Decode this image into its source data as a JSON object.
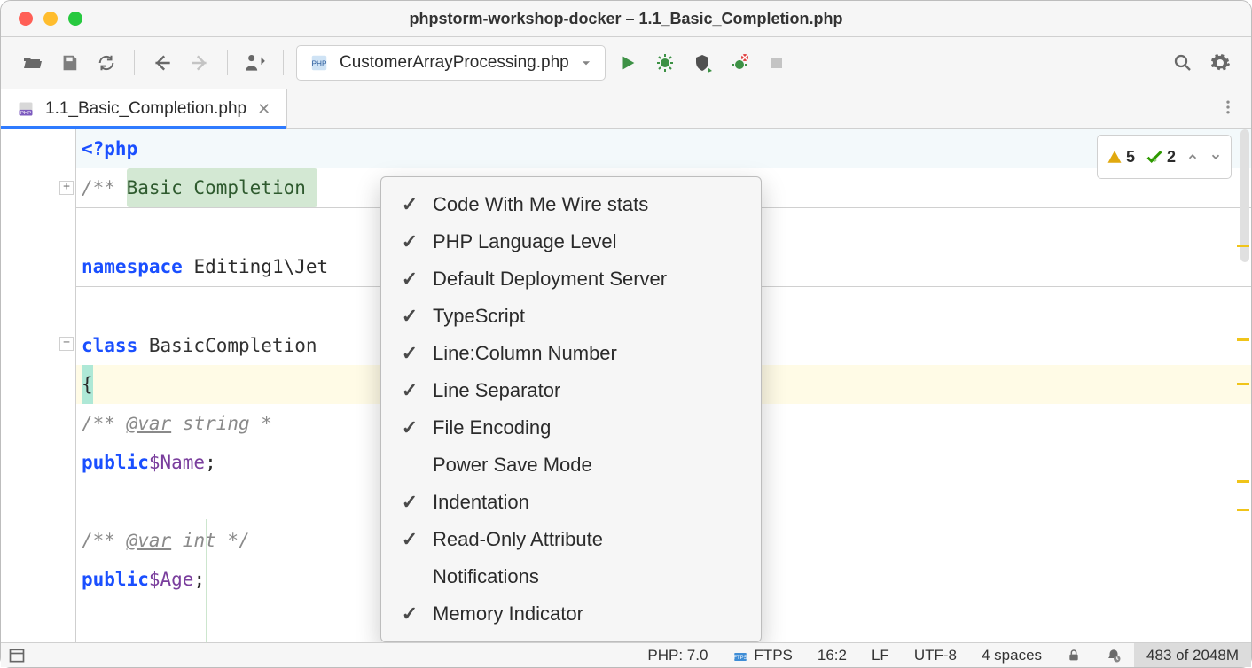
{
  "window": {
    "title": "phpstorm-workshop-docker – 1.1_Basic_Completion.php"
  },
  "runConfig": {
    "label": "CustomerArrayProcessing.php"
  },
  "tab": {
    "label": "1.1_Basic_Completion.php"
  },
  "inspections": {
    "warnings": "5",
    "oks": "2"
  },
  "code": {
    "l1": "<?php",
    "doc_lead": "/** ",
    "doc_title": "Basic Completion ",
    "namespace_kw": "namespace ",
    "namespace_val": "Editing1\\Jet",
    "class_kw": "class ",
    "class_name": "BasicCompletion",
    "brace_open": "{",
    "doc_var1_a": "/** ",
    "doc_var1_tag": "@var",
    "doc_var1_b": " string *",
    "public_kw": "public",
    "name_var": "$Name",
    "semi": ";",
    "doc_var2_a": "/** ",
    "doc_var2_tag": "@var",
    "doc_var2_b": " int */",
    "age_var": "$Age"
  },
  "menu": {
    "items": [
      {
        "label": "Code With Me Wire stats",
        "checked": true
      },
      {
        "label": "PHP Language Level",
        "checked": true
      },
      {
        "label": "Default Deployment Server",
        "checked": true
      },
      {
        "label": "TypeScript",
        "checked": true
      },
      {
        "label": "Line:Column Number",
        "checked": true
      },
      {
        "label": "Line Separator",
        "checked": true
      },
      {
        "label": "File Encoding",
        "checked": true
      },
      {
        "label": "Power Save Mode",
        "checked": false
      },
      {
        "label": "Indentation",
        "checked": true
      },
      {
        "label": "Read-Only Attribute",
        "checked": true
      },
      {
        "label": "Notifications",
        "checked": false
      },
      {
        "label": "Memory Indicator",
        "checked": true
      }
    ]
  },
  "status": {
    "php": "PHP: 7.0",
    "ftps": "FTPS",
    "pos": "16:2",
    "eol": "LF",
    "enc": "UTF-8",
    "indent": "4 spaces",
    "memory": "483 of 2048M"
  }
}
